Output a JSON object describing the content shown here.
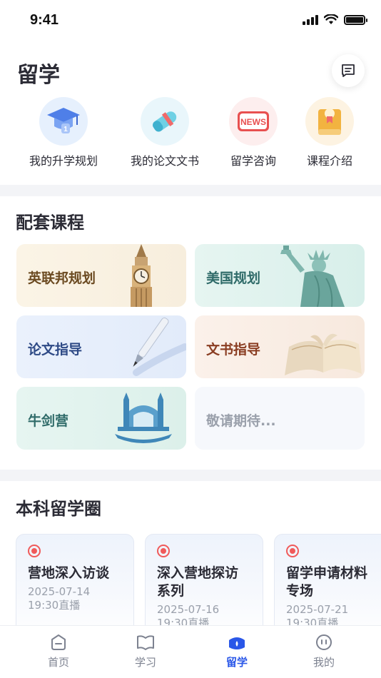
{
  "status_bar": {
    "time": "9:41"
  },
  "header": {
    "title": "留学"
  },
  "quick_nav": [
    {
      "label": "我的升学规划",
      "icon": "graduation-cap-icon"
    },
    {
      "label": "我的论文文书",
      "icon": "diploma-scroll-icon"
    },
    {
      "label": "留学咨询",
      "icon": "news-icon"
    },
    {
      "label": "课程介绍",
      "icon": "course-book-icon"
    }
  ],
  "courses": {
    "title": "配套课程",
    "items": [
      {
        "label": "英联邦规划",
        "color": "#6b4a21",
        "art": "big-ben-icon"
      },
      {
        "label": "美国规划",
        "color": "#2f6b69",
        "art": "statue-of-liberty-icon"
      },
      {
        "label": "论文指导",
        "color": "#2e4a86",
        "art": "pen-icon"
      },
      {
        "label": "文书指导",
        "color": "#8a3d22",
        "art": "open-book-icon"
      },
      {
        "label": "牛剑营",
        "color": "#2f6b69",
        "art": "college-building-icon"
      },
      {
        "label": "敬请期待...",
        "color": "#9aa0ab",
        "art": ""
      }
    ]
  },
  "circle": {
    "title": "本科留学圈",
    "items": [
      {
        "title": "营地深入访谈",
        "date": "2025-07-14",
        "time": "19:30直播"
      },
      {
        "title": "深入营地探访系列",
        "date": "2025-07-16",
        "time": "19:30直播"
      },
      {
        "title": "留学申请材料专场",
        "date": "2025-07-21",
        "time": "19:30直播"
      }
    ]
  },
  "tab_bar": {
    "active": "留学",
    "active_color": "#2a57e8",
    "items": [
      {
        "label": "首页",
        "icon": "home-icon"
      },
      {
        "label": "学习",
        "icon": "book-icon"
      },
      {
        "label": "留学",
        "icon": "study-abroad-cap-icon"
      },
      {
        "label": "我的",
        "icon": "profile-icon"
      }
    ]
  }
}
